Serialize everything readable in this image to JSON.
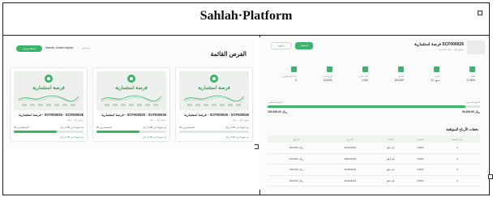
{
  "document": {
    "title": "Sahlah·Platform"
  },
  "left_screenshot": {
    "header": {
      "button_label": "اضافة فرصة",
      "user_name": "Samah Juhani Najmer",
      "user_sub": "مستثمر",
      "section_title": "الفرص القائمة"
    },
    "cards": [
      {
        "image_title": "فرصة استثمارية",
        "title": "فرصة استثمارية - SCF000026 - SCF000026",
        "subtitle": "تمويل أول - مكة",
        "left_value": "00 المستثمرين",
        "right_value": "تم جمع 0 من 0,00 ريال",
        "progress": 0,
        "bottom": "تم جمع 0 من 0,00 ريال"
      },
      {
        "image_title": "فرصة استثمارية",
        "title": "فرصة استثمارية - SCF000026 - SCF000026",
        "subtitle": "تمويل أول - مكة",
        "left_value": "00 المستثمرين",
        "right_value": "تم جمع 0 من 0,00 ريال",
        "progress": 0.62,
        "bottom": "تم جمع 0 من 0,00 ريال"
      },
      {
        "image_title": "فرصة استثمارية",
        "title": "فرصة استثمارية - SCF000026 - SCF000026",
        "subtitle": "تمويل أول - مكة",
        "left_value": "00 المستثمرين",
        "right_value": "تم جمع 0 من 0,00 ريال",
        "progress": 0.62,
        "bottom": "تم جمع 0 من 0,00 ريال"
      }
    ]
  },
  "right_screenshot": {
    "header": {
      "title": "فرصة استثمارية SCF000026",
      "subtitle": "تمويل أول - مكة المكرمة",
      "invest_button": "استثمر",
      "back_button": "رجوع"
    },
    "stats": [
      {
        "label": "العائد",
        "value": "17.50%"
      },
      {
        "label": "المدة",
        "value": "12 شهر"
      },
      {
        "label": "المبلغ",
        "value": "100,000"
      },
      {
        "label": "الحد الأدنى",
        "value": "1,000"
      },
      {
        "label": "تاريخ البدء",
        "value": "11/2022"
      },
      {
        "label": "عدد المستثمرين",
        "value": "0"
      }
    ],
    "progress": {
      "left_label": "المبلغ المطلوب",
      "right_label": "المبلغ المجمع",
      "fraction": 0.93,
      "left_value": "100,000.00 ريال",
      "right_value": "93,000.00 ريال"
    },
    "table": {
      "title": "دفعات الأرباح المتوقعة",
      "columns": [
        "المبلغ",
        "التاريخ",
        "الحالة",
        "النسبة",
        "رقم الدفعة"
      ],
      "rows": [
        [
          "150,000 ريال",
          "30/11/2022",
          "لم تدفع",
          "3.56%",
          "1"
        ],
        [
          "150,000 ريال",
          "28/02/2023",
          "لم تدفع",
          "3.56%",
          "2"
        ],
        [
          "150,000 ريال",
          "31/05/2023",
          "لم تدفع",
          "3.56%",
          "3"
        ],
        [
          "150,000 ريال",
          "31/08/2023",
          "لم تدفع",
          "3.56%",
          "4"
        ]
      ]
    }
  }
}
